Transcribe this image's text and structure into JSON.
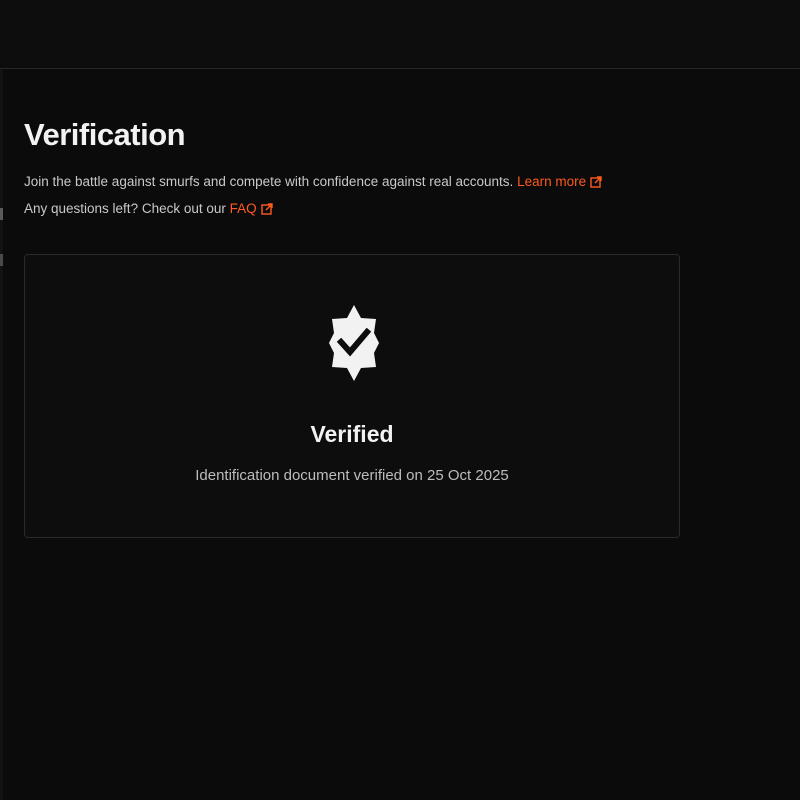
{
  "header": {
    "title": "Verification",
    "description_line1": "Join the battle against smurfs and compete with confidence against real accounts.",
    "learn_more_label": "Learn more",
    "description_line2": "Any questions left? Check out our",
    "faq_label": "FAQ"
  },
  "status_card": {
    "icon": "verified-badge-icon",
    "title": "Verified",
    "subtitle": "Identification document verified on 25 Oct 2025"
  },
  "colors": {
    "background": "#0b0b0b",
    "accent": "#ff5a1f",
    "card_border": "#2a2a2a"
  }
}
